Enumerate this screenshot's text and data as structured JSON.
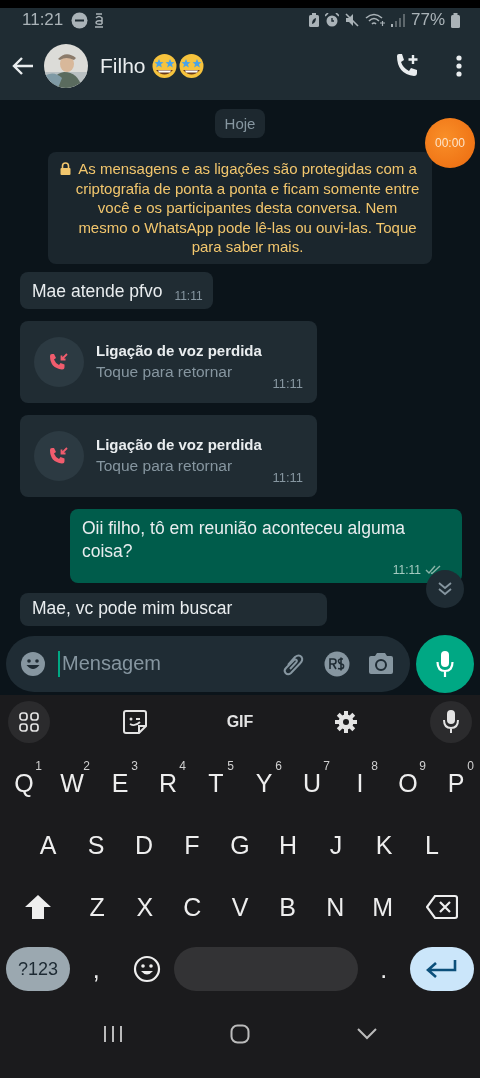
{
  "status_bar": {
    "time": "11:21",
    "battery": "77%"
  },
  "header": {
    "contact_name": "Filho"
  },
  "chat": {
    "date_chip": "Hoje",
    "timer": "00:00",
    "encryption_notice": "As mensagens e as ligações são protegidas com a criptografia de ponta a ponta e ficam somente entre você e os participantes desta conversa. Nem mesmo o WhatsApp pode lê-las ou ouvi-las. Toque para saber mais.",
    "messages": [
      {
        "kind": "text",
        "outgoing": false,
        "text": "Mae atende pfvo",
        "time": "11:11"
      },
      {
        "kind": "missed_call",
        "outgoing": false,
        "title": "Ligação de voz perdida",
        "subtitle": "Toque para retornar",
        "time": "11:11"
      },
      {
        "kind": "missed_call",
        "outgoing": false,
        "title": "Ligação de voz perdida",
        "subtitle": "Toque para retornar",
        "time": "11:11"
      },
      {
        "kind": "text",
        "outgoing": true,
        "text": "Oii filho, tô em reunião aconteceu alguma coisa?",
        "time": "11:11",
        "read": false
      },
      {
        "kind": "text",
        "outgoing": false,
        "text": "Mae, vc pode mim buscar"
      }
    ]
  },
  "composer": {
    "placeholder": "Mensagem"
  },
  "keyboard": {
    "toolbar_label": "GIF",
    "rows": [
      {
        "keys": [
          {
            "kind": "letter",
            "label": "Q",
            "hint": "1"
          },
          {
            "kind": "letter",
            "label": "W",
            "hint": "2"
          },
          {
            "kind": "letter",
            "label": "E",
            "hint": "3"
          },
          {
            "kind": "letter",
            "label": "R",
            "hint": "4"
          },
          {
            "kind": "letter",
            "label": "T",
            "hint": "5"
          },
          {
            "kind": "letter",
            "label": "Y",
            "hint": "6"
          },
          {
            "kind": "letter",
            "label": "U",
            "hint": "7"
          },
          {
            "kind": "letter",
            "label": "I",
            "hint": "8"
          },
          {
            "kind": "letter",
            "label": "O",
            "hint": "9"
          },
          {
            "kind": "letter",
            "label": "P",
            "hint": "0"
          }
        ]
      },
      {
        "keys": [
          {
            "kind": "letter",
            "label": "A"
          },
          {
            "kind": "letter",
            "label": "S"
          },
          {
            "kind": "letter",
            "label": "D"
          },
          {
            "kind": "letter",
            "label": "F"
          },
          {
            "kind": "letter",
            "label": "G"
          },
          {
            "kind": "letter",
            "label": "H"
          },
          {
            "kind": "letter",
            "label": "J"
          },
          {
            "kind": "letter",
            "label": "K"
          },
          {
            "kind": "letter",
            "label": "L"
          }
        ]
      },
      {
        "keys": [
          {
            "kind": "shift"
          },
          {
            "kind": "letter",
            "label": "Z"
          },
          {
            "kind": "letter",
            "label": "X"
          },
          {
            "kind": "letter",
            "label": "C"
          },
          {
            "kind": "letter",
            "label": "V"
          },
          {
            "kind": "letter",
            "label": "B"
          },
          {
            "kind": "letter",
            "label": "N"
          },
          {
            "kind": "letter",
            "label": "M"
          },
          {
            "kind": "backspace"
          }
        ]
      },
      {
        "keys": [
          {
            "kind": "symbols",
            "label": "?123"
          },
          {
            "kind": "punct",
            "label": ","
          },
          {
            "kind": "emoji"
          },
          {
            "kind": "space"
          },
          {
            "kind": "punct",
            "label": "."
          },
          {
            "kind": "enter"
          }
        ]
      }
    ]
  }
}
